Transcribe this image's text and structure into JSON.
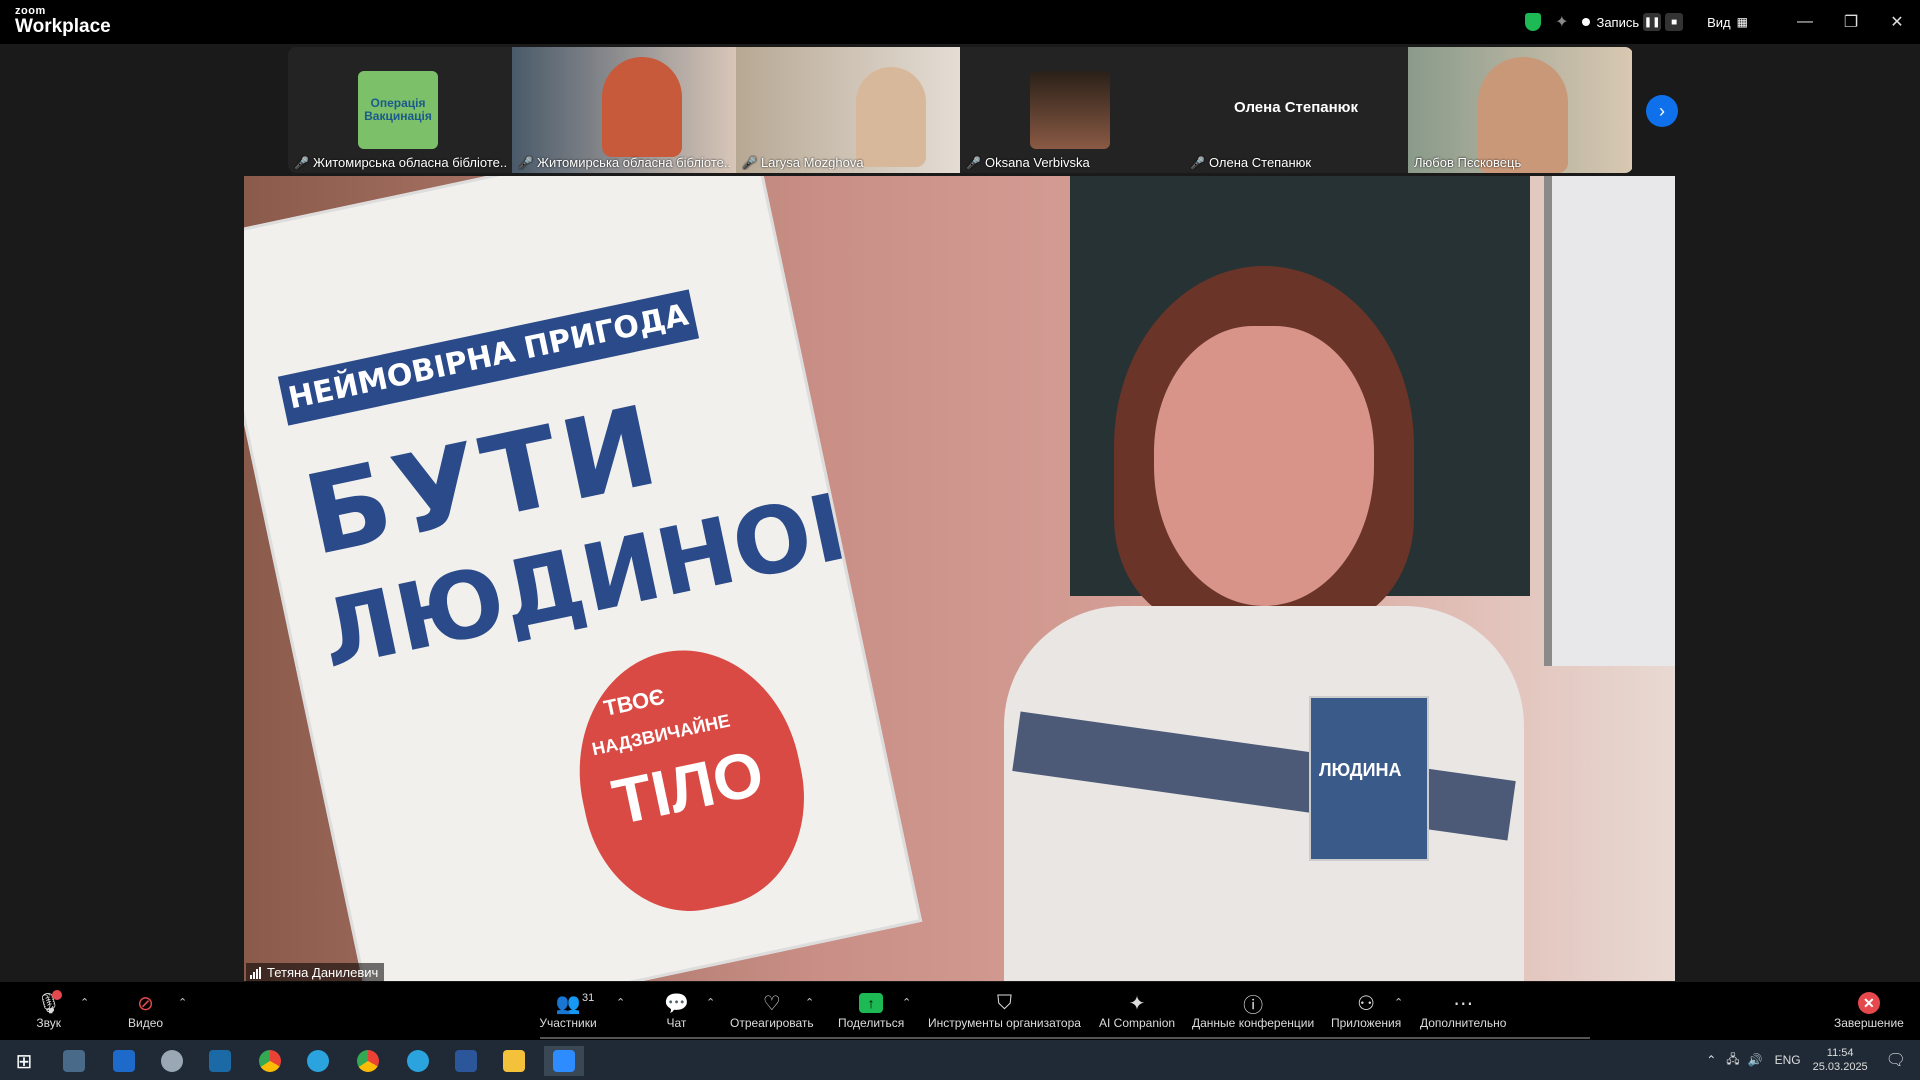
{
  "app": {
    "logo_small": "zoom",
    "logo_big": "Workplace"
  },
  "titlebar": {
    "record_label": "Запись",
    "view_label": "Вид",
    "minimize": "—",
    "restore": "❐",
    "close": "✕"
  },
  "participants": [
    {
      "name": "Житомирська обласна бібліоте...",
      "muted": true,
      "avatar_text": "Операція Вакцинація"
    },
    {
      "name": "Житомирська обласна бібліоте...",
      "muted": true
    },
    {
      "name": "Larysa Mozghova",
      "muted": true
    },
    {
      "name": "Oksana Verbivska",
      "muted": true
    },
    {
      "name": "Олена Степанюк",
      "muted": true,
      "center_name": "Олена Степанюк"
    },
    {
      "name": "Любов Пєсковець",
      "muted": false
    }
  ],
  "main_video": {
    "speaker": "Тетяна Данилевич",
    "book_banner": "НЕЙМОВІРНА ПРИГОДА",
    "book_title_1": "БУТИ",
    "book_title_2": "ЛЮДИНОЮ",
    "book_heart_1": "ТВОЄ",
    "book_heart_2": "НАДЗВИЧАЙНЕ",
    "book_heart_3": "ТІЛО",
    "small_book": "ЛЮДИНА"
  },
  "toolbar": {
    "audio": "Звук",
    "video": "Видео",
    "participants": "Участники",
    "participants_count": "31",
    "chat": "Чат",
    "react": "Отреагировать",
    "share": "Поделиться",
    "host_tools": "Инструменты организатора",
    "ai": "AI Companion",
    "info": "Данные конференции",
    "apps": "Приложения",
    "more": "Дополнительно",
    "end": "Завершение"
  },
  "taskbar": {
    "lang": "ENG",
    "time": "11:54",
    "date": "25.03.2025"
  },
  "colors": {
    "accent_blue": "#0e71eb",
    "share_green": "#1db954",
    "end_red": "#e5484d"
  }
}
